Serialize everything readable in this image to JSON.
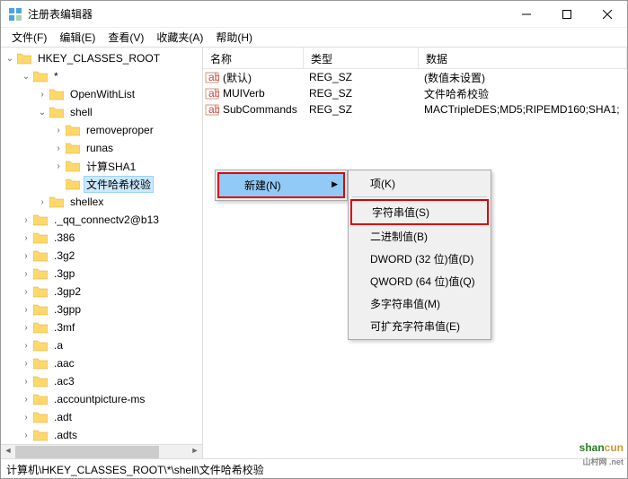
{
  "window": {
    "title": "注册表编辑器"
  },
  "menubar": [
    "文件(F)",
    "编辑(E)",
    "查看(V)",
    "收藏夹(A)",
    "帮助(H)"
  ],
  "tree": {
    "root": "HKEY_CLASSES_ROOT",
    "star": "*",
    "items": [
      "OpenWithList",
      "shell",
      "removeproper",
      "runas",
      "计算SHA1",
      "文件哈希校验",
      "shellex",
      "._qq_connectv2@b13",
      ".386",
      ".3g2",
      ".3gp",
      ".3gp2",
      ".3gpp",
      ".3mf",
      ".a",
      ".aac",
      ".ac3",
      ".accountpicture-ms",
      ".adt",
      ".adts"
    ]
  },
  "list": {
    "headers": [
      "名称",
      "类型",
      "数据"
    ],
    "rows": [
      {
        "name": "(默认)",
        "type": "REG_SZ",
        "data": "(数值未设置)"
      },
      {
        "name": "MUIVerb",
        "type": "REG_SZ",
        "data": "文件哈希校验"
      },
      {
        "name": "SubCommands",
        "type": "REG_SZ",
        "data": "MACTripleDES;MD5;RIPEMD160;SHA1;"
      }
    ]
  },
  "context1": {
    "new": "新建(N)"
  },
  "context2": [
    "项(K)",
    "字符串值(S)",
    "二进制值(B)",
    "DWORD (32 位)值(D)",
    "QWORD (64 位)值(Q)",
    "多字符串值(M)",
    "可扩充字符串值(E)"
  ],
  "statusbar": "计算机\\HKEY_CLASSES_ROOT\\*\\shell\\文件哈希校验",
  "watermark": {
    "p1": "shan",
    "p2": "cun",
    "sub": "山村网 .net"
  }
}
